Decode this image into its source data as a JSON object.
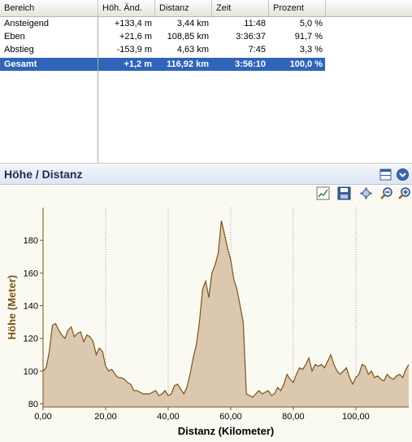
{
  "table": {
    "headers": [
      "Bereich",
      "Höh. Änd.",
      "Distanz",
      "Zeit",
      "Prozent"
    ],
    "rows": [
      {
        "bereich": "Ansteigend",
        "hoehe": "+133,4 m",
        "distanz": "3,44 km",
        "zeit": "11:48",
        "prozent": "5,0 %"
      },
      {
        "bereich": "Eben",
        "hoehe": "+21,6 m",
        "distanz": "108,85 km",
        "zeit": "3:36:37",
        "prozent": "91,7 %"
      },
      {
        "bereich": "Abstieg",
        "hoehe": "-153,9 m",
        "distanz": "4,63 km",
        "zeit": "7:45",
        "prozent": "3,3 %"
      }
    ],
    "total": {
      "bereich": "Gesamt",
      "hoehe": "+1,2 m",
      "distanz": "116,92 km",
      "zeit": "3:56:10",
      "prozent": "100,0 %"
    }
  },
  "panel": {
    "title": "Höhe / Distanz",
    "icons": [
      "layout-toggle-icon",
      "collapse-chevron-icon"
    ],
    "tools": [
      "chart-settings-icon",
      "save-icon",
      "zoom-fit-icon",
      "zoom-out-icon",
      "zoom-in-icon"
    ]
  },
  "chart_data": {
    "type": "area",
    "xlabel": "Distanz (Kilometer)",
    "ylabel": "Höhe (Meter)",
    "xlim": [
      0,
      116.92
    ],
    "ylim": [
      78,
      200
    ],
    "xticks": [
      "0,00",
      "20,00",
      "40,00",
      "60,00",
      "80,00",
      "100,00"
    ],
    "yticks": [
      "80",
      "100",
      "120",
      "140",
      "160",
      "180"
    ],
    "grid": "vertical",
    "colors": {
      "fill": "#dcc8ae",
      "line": "#7a5418",
      "axis_text": "#7a5418"
    },
    "series": [
      {
        "x": [
          0,
          1,
          2,
          3,
          4,
          5,
          6,
          7,
          8,
          9,
          10,
          11,
          12,
          13,
          14,
          15,
          16,
          17,
          18,
          19,
          20,
          21,
          22,
          23,
          24,
          25,
          26,
          27,
          28,
          29,
          30,
          31,
          32,
          33,
          34,
          35,
          36,
          37,
          38,
          39,
          40,
          41,
          42,
          43,
          44,
          45,
          46,
          47,
          48,
          49,
          50,
          51,
          52,
          53,
          54,
          55,
          56,
          57,
          58,
          59,
          60,
          61,
          62,
          63,
          64,
          65,
          66,
          67,
          68,
          69,
          70,
          71,
          72,
          73,
          74,
          75,
          76,
          77,
          78,
          79,
          80,
          81,
          82,
          83,
          84,
          85,
          86,
          87,
          88,
          89,
          90,
          91,
          92,
          93,
          94,
          95,
          96,
          97,
          98,
          99,
          100,
          101,
          102,
          103,
          104,
          105,
          106,
          107,
          108,
          109,
          110,
          111,
          112,
          113,
          114,
          115,
          116,
          116.92
        ],
        "y": [
          100,
          102,
          112,
          128,
          129,
          125,
          122,
          120,
          125,
          127,
          121,
          123,
          124,
          118,
          122,
          121,
          118,
          110,
          114,
          112,
          103,
          100,
          101,
          98,
          96,
          96,
          95,
          93,
          92,
          88,
          88,
          87,
          86,
          86,
          86,
          87,
          88,
          85,
          86,
          88,
          85,
          86,
          91,
          92,
          89,
          86,
          90,
          98,
          108,
          116,
          130,
          150,
          155,
          145,
          160,
          165,
          172,
          192,
          184,
          175,
          168,
          156,
          150,
          140,
          130,
          86,
          85,
          84,
          86,
          88,
          86,
          87,
          88,
          85,
          86,
          90,
          88,
          92,
          98,
          95,
          93,
          98,
          102,
          101,
          104,
          108,
          100,
          104,
          103,
          104,
          102,
          106,
          110,
          104,
          100,
          98,
          100,
          102,
          96,
          92,
          96,
          98,
          104,
          103,
          98,
          100,
          96,
          97,
          95,
          94,
          98,
          96,
          95,
          97,
          98,
          96,
          101,
          104
        ]
      }
    ]
  }
}
